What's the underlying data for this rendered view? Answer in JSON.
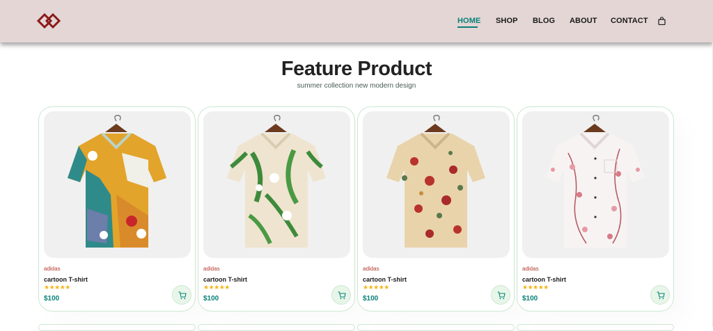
{
  "header": {
    "nav": [
      {
        "label": "HOME",
        "active": true
      },
      {
        "label": "SHOP",
        "active": false
      },
      {
        "label": "BLOG",
        "active": false
      },
      {
        "label": "ABOUT",
        "active": false
      },
      {
        "label": "CONTACT",
        "active": false
      }
    ],
    "cart_icon": "shopping-bag-icon",
    "logo": "diamond-logo"
  },
  "section": {
    "title": "Feature Product",
    "subtitle": "summer collection new modern design"
  },
  "products": [
    {
      "brand": "adidas",
      "name": "cartoon T-shirt",
      "stars": "★★★★★",
      "price": "$100",
      "image": "colorful-abstract-shirt"
    },
    {
      "brand": "adidas",
      "name": "cartoon T-shirt",
      "stars": "★★★★★",
      "price": "$100",
      "image": "leaf-print-shirt"
    },
    {
      "brand": "adidas",
      "name": "cartoon T-shirt",
      "stars": "★★★★★",
      "price": "$100",
      "image": "floral-cream-shirt"
    },
    {
      "brand": "adidas",
      "name": "cartoon T-shirt",
      "stars": "★★★★★",
      "price": "$100",
      "image": "pink-blossom-shirt"
    }
  ],
  "colors": {
    "accent": "#088178",
    "header_bg": "#e3d6d5",
    "brand_text": "#b03a2e",
    "star": "#f3b519"
  }
}
